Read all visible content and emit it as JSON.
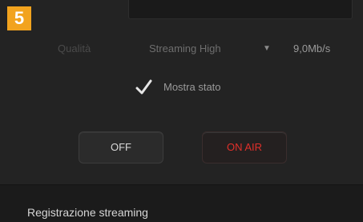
{
  "step_badge": "5",
  "quality": {
    "label": "Qualità",
    "selected": "Streaming High",
    "bitrate": "9,0Mb/s"
  },
  "show_status": {
    "label": "Mostra stato",
    "checked": true
  },
  "buttons": {
    "off_label": "OFF",
    "on_air_label": "ON AIR"
  },
  "section": {
    "title": "Registrazione streaming"
  },
  "colors": {
    "badge": "#f2a31e",
    "on_air_text": "#e0302a",
    "background": "#232323"
  }
}
